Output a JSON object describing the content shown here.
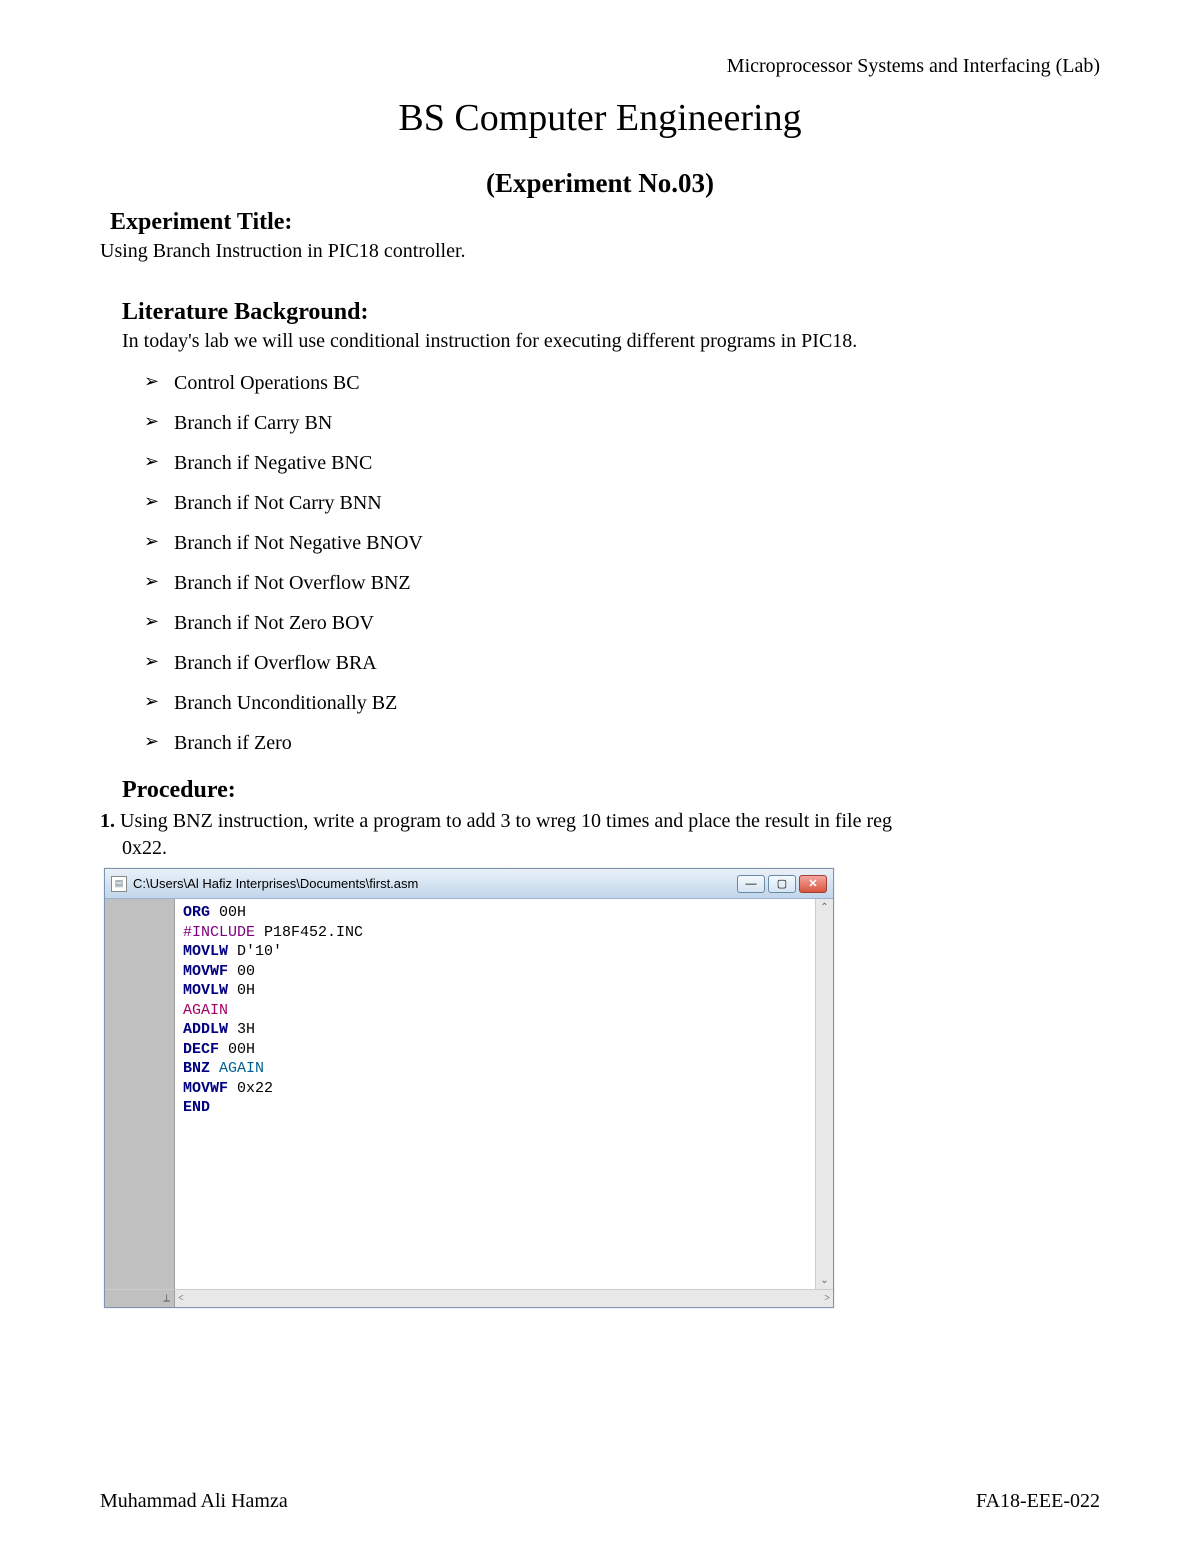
{
  "header_right": "Microprocessor Systems and Interfacing (Lab)",
  "main_title": "BS Computer Engineering",
  "exp_no": "(Experiment No.03)",
  "sections": {
    "exp_title_heading": "Experiment Title:",
    "exp_title_body": "Using Branch Instruction in PIC18 controller.",
    "lit_heading": "Literature Background:",
    "lit_body": "In today's lab we will use conditional instruction for executing different programs in PIC18.",
    "bullets": [
      "Control Operations BC",
      "Branch if Carry BN",
      "Branch if Negative BNC",
      "Branch if Not Carry BNN",
      "Branch if Not Negative BNOV",
      "Branch if Not Overflow BNZ",
      "Branch if Not Zero BOV",
      "Branch if Overflow BRA",
      "Branch Unconditionally BZ",
      "Branch if Zero"
    ],
    "proc_heading": "Procedure:",
    "proc_step_num": "1.",
    "proc_step_text_a": "Using BNZ instruction, write a program to add 3 to wreg 10 times and place the result in file reg",
    "proc_step_text_b": "0x22."
  },
  "editor": {
    "title": "C:\\Users\\Al Hafiz Interprises\\Documents\\first.asm",
    "code": [
      {
        "t": "ORG",
        "c": "kw",
        "r": " 00H"
      },
      {
        "t": "#INCLUDE",
        "c": "dir",
        "r": " P18F452.INC"
      },
      {
        "t": "MOVLW",
        "c": "kw",
        "r": " D'10'"
      },
      {
        "t": "MOVWF",
        "c": "kw",
        "r": " 00"
      },
      {
        "t": "MOVLW",
        "c": "kw",
        "r": " 0H"
      },
      {
        "t": "AGAIN",
        "c": "lbl",
        "r": ""
      },
      {
        "t": "ADDLW",
        "c": "kw",
        "r": " 3H"
      },
      {
        "t": "DECF",
        "c": "kw",
        "r": " 00H"
      },
      {
        "t": "BNZ",
        "c": "kw",
        "r": " AGAIN",
        "rc": "op"
      },
      {
        "t": "MOVWF",
        "c": "kw",
        "r": " 0x22"
      },
      {
        "t": "END",
        "c": "kw",
        "r": ""
      }
    ]
  },
  "footer": {
    "left": "Muhammad Ali Hamza",
    "right": "FA18-EEE-022"
  }
}
